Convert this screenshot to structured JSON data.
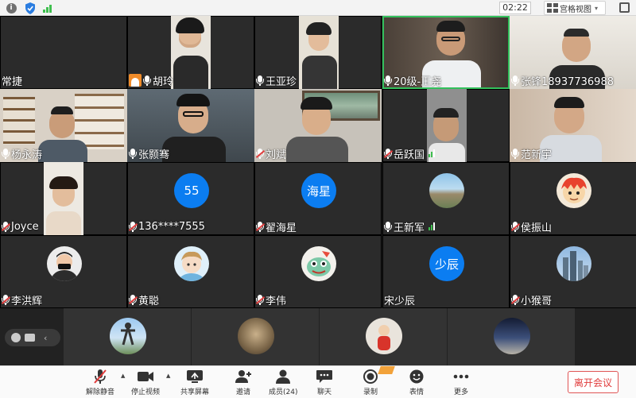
{
  "topbar": {
    "timer": "02:22",
    "view_label": "宫格视图",
    "view_caret": "▾"
  },
  "tiles": [
    {
      "name": "常捷",
      "mic": "none"
    },
    {
      "name": "胡玲",
      "mic": "on",
      "host": true
    },
    {
      "name": "王亚珍",
      "mic": "on"
    },
    {
      "name": "20级-王尧",
      "mic": "on"
    },
    {
      "name": "张锋18937736988",
      "mic": "on"
    },
    {
      "name": "杨永涛",
      "mic": "on"
    },
    {
      "name": "张颢骞",
      "mic": "on"
    },
    {
      "name": "刘斌",
      "mic": "off"
    },
    {
      "name": "岳跃国",
      "mic": "off",
      "signal": true
    },
    {
      "name": "范新宇",
      "mic": "on"
    },
    {
      "name": "Joyce",
      "mic": "off"
    },
    {
      "name": "136****7555",
      "mic": "off",
      "avatar_text": "55"
    },
    {
      "name": "翟海星",
      "mic": "off",
      "avatar_text": "海星"
    },
    {
      "name": "王新军",
      "mic": "on",
      "signal": true
    },
    {
      "name": "侯振山",
      "mic": "off"
    },
    {
      "name": "李洪辉",
      "mic": "off"
    },
    {
      "name": "黄聪",
      "mic": "off"
    },
    {
      "name": "李伟",
      "mic": "off"
    },
    {
      "name": "宋少辰",
      "mic": "none",
      "avatar_text": "少辰"
    },
    {
      "name": "小猴哥",
      "mic": "off"
    }
  ],
  "toolbar": {
    "unmute": "解除静音",
    "stop_video": "停止视频",
    "share_screen": "共享屏幕",
    "invite": "邀请",
    "members": "成员(24)",
    "chat": "聊天",
    "record": "录制",
    "reactions": "表情",
    "more": "更多",
    "leave": "离开会议"
  },
  "colors": {
    "accent": "#0b7df1",
    "leave_red": "#e03a3a",
    "host_orange": "#f08c2a"
  }
}
